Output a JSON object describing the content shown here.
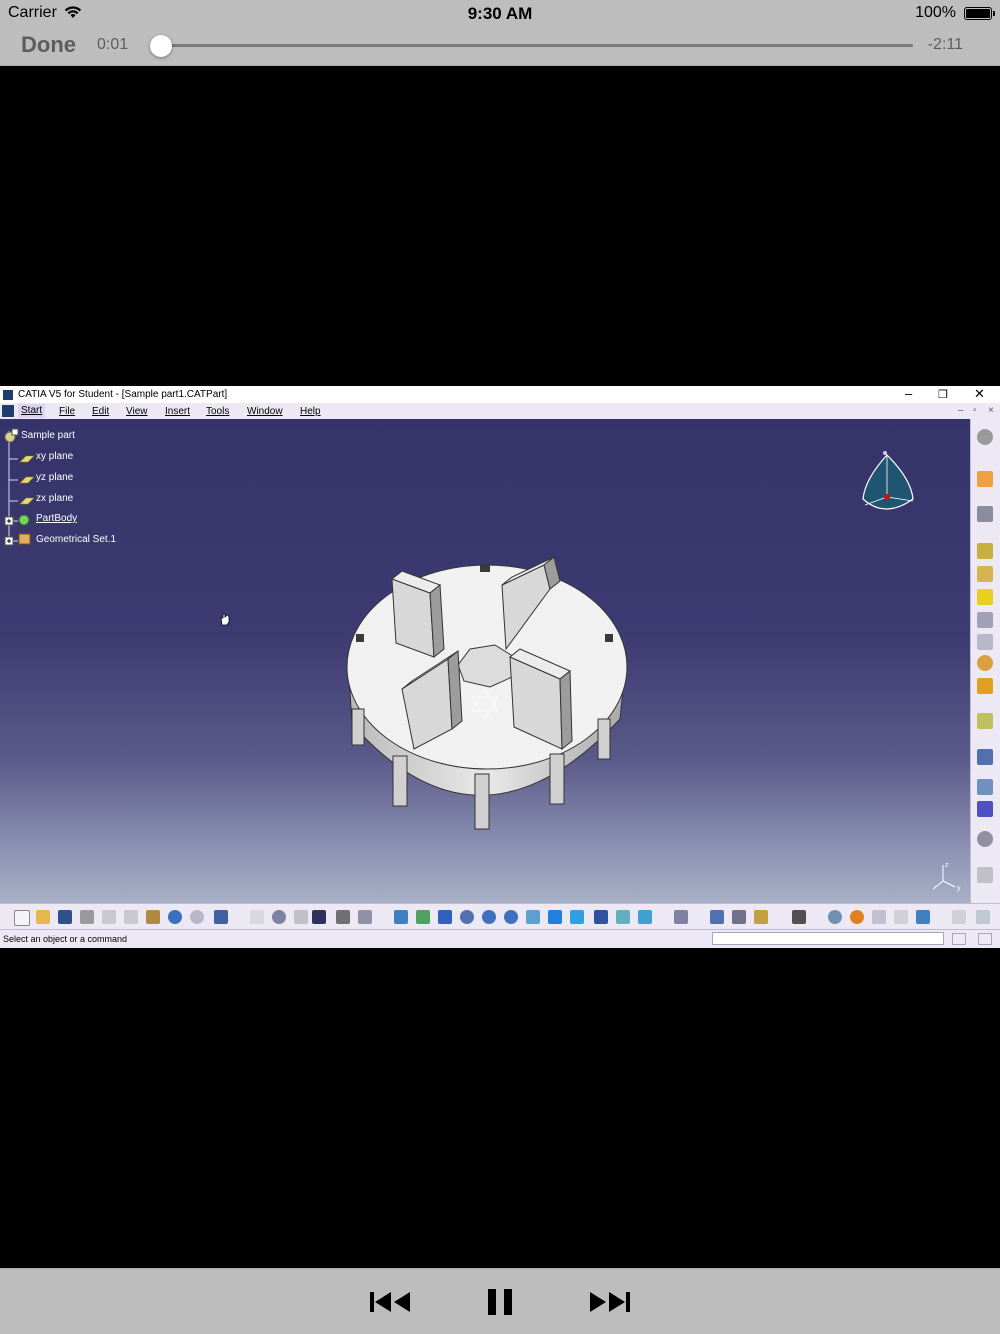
{
  "status_bar": {
    "carrier": "Carrier",
    "time": "9:30 AM",
    "battery": "100%"
  },
  "player": {
    "done_label": "Done",
    "elapsed": "0:01",
    "remaining": "-2:11",
    "progress": 0.008,
    "controls": [
      "rewind-icon",
      "pause-icon",
      "fast-forward-icon"
    ]
  },
  "catia": {
    "window_title": "CATIA V5 for Student - [Sample part1.CATPart]",
    "menus": [
      "Start",
      "File",
      "Edit",
      "View",
      "Insert",
      "Tools",
      "Window",
      "Help"
    ],
    "tree": [
      {
        "label": "Sample part",
        "level": 0
      },
      {
        "label": "xy plane",
        "level": 1
      },
      {
        "label": "yz plane",
        "level": 1
      },
      {
        "label": "zx plane",
        "level": 1
      },
      {
        "label": "PartBody",
        "level": 1
      },
      {
        "label": "Geometrical Set.1",
        "level": 1
      }
    ],
    "status_text": "Select an object or a command",
    "colors": {
      "viewport_top": "#36336a",
      "viewport_bottom": "#a8b0c7",
      "panel": "#ece9f4"
    }
  }
}
